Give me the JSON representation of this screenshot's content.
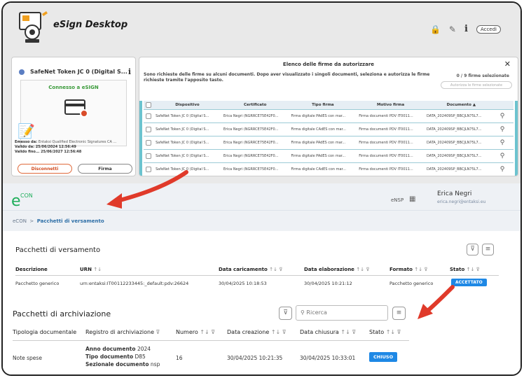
{
  "app": {
    "title": "eSign Desktop",
    "accedi_label": "Accedi"
  },
  "token_panel": {
    "token_name": "SafeNet Token JC 0 (Digital S...",
    "connected_label": "Connesso a eSIGN",
    "issuer_label": "Emesso da:",
    "issuer_value": "Entaksi Qualified Electronic Signatures CA ...",
    "valid_from_label": "Valido da:",
    "valid_from_value": "25/06/2024 12:56:49",
    "valid_to_label": "Valido fino...",
    "valid_to_value": "25/06/2027 12:56:48",
    "disconnect_label": "Disconnetti",
    "sign_label": "Firma"
  },
  "signatures_panel": {
    "title": "Elenco delle firme da autorizzare",
    "description": "Sono richieste delle firme su alcuni documenti. Dopo aver visualizzato i singoli documenti, seleziona e autorizza le firme richieste tramite l'apposito tasto.",
    "selected_count": "0 / 9 firme selezionate",
    "authorize_label": "Autorizza le firme selezionate",
    "columns": [
      "Dispositivo",
      "Certificato",
      "Tipo firma",
      "Motivo firma",
      "Documento"
    ],
    "rows": [
      [
        "SafeNet Token JC 0 (Digital S...",
        "Erica Negri (NGRRCE75E42F0...",
        "Firma digitale PAdES con mar...",
        "Firma documenti PDV IT0011...",
        "DATA_202409SP_BBCJLN75L7..."
      ],
      [
        "SafeNet Token JC 0 (Digital S...",
        "Erica Negri (NGRRCE75E42F0...",
        "Firma digitale CAdES con mar...",
        "Firma documenti PDV IT0011...",
        "DATA_202409SP_BBCJLN75L7..."
      ],
      [
        "SafeNet Token JC 0 (Digital S...",
        "Erica Negri (NGRRCE75E42F0...",
        "Firma digitale PAdES con mar...",
        "Firma documenti PDV IT0011...",
        "DATA_202409SP_BBCJLN75L7..."
      ],
      [
        "SafeNet Token JC 0 (Digital S...",
        "Erica Negri (NGRRCE75E42F0...",
        "Firma digitale PAdES con mar...",
        "Firma documenti PDV IT0011...",
        "DATA_202409SP_BBCJLN75L7..."
      ],
      [
        "SafeNet Token JC 0 (Digital S...",
        "Erica Negri (NGRRCE75E42F0...",
        "Firma digitale CAdES con mar...",
        "Firma documenti PDV IT0011...",
        "DATA_202409SP_BBCJLN75L7..."
      ]
    ]
  },
  "econ": {
    "logo_text": "CON",
    "ensp_label": "eNSP",
    "user_name": "Erica Negri",
    "user_email": "erica.negri@entaksi.eu",
    "breadcrumb_root": "eCON",
    "breadcrumb_sep": ">",
    "breadcrumb_active": "Pacchetti di versamento"
  },
  "versamento": {
    "title": "Pacchetti di versamento",
    "columns": [
      "Descrizione",
      "URN",
      "Data caricamento",
      "Data elaborazione",
      "Formato",
      "Stato"
    ],
    "row": {
      "descrizione": "Pacchetto generico",
      "urn": "urn:entaksi:IT00112233445:_default:pdv:26624",
      "data_caricamento": "30/04/2025 10:18:53",
      "data_elaborazione": "30/04/2025 10:21:12",
      "formato": "Pacchetto generico",
      "stato": "ACCETTATO"
    }
  },
  "archiviazione": {
    "title": "Pacchetti di archiviazione",
    "search_placeholder": "Ricerca",
    "columns": [
      "Tipologia documentale",
      "Registro di archiviazione",
      "Numero",
      "Data creazione",
      "Data chiusura",
      "Stato"
    ],
    "row": {
      "tipologia": "Note spese",
      "anno_label": "Anno documento",
      "anno_value": "2024",
      "tipo_label": "Tipo documento",
      "tipo_value": "D85",
      "sezionale_label": "Sezionale documento",
      "sezionale_value": "nsp",
      "numero": "16",
      "data_creazione": "30/04/2025 10:21:35",
      "data_chiusura": "30/04/2025 10:33:01",
      "stato": "CHIUSO"
    }
  },
  "colors": {
    "accent": "#1e88e5",
    "connected": "#3a9a3a",
    "disconnect": "#d14b1f",
    "arrow": "#e03a2a",
    "econ_green": "#1fae5b"
  }
}
